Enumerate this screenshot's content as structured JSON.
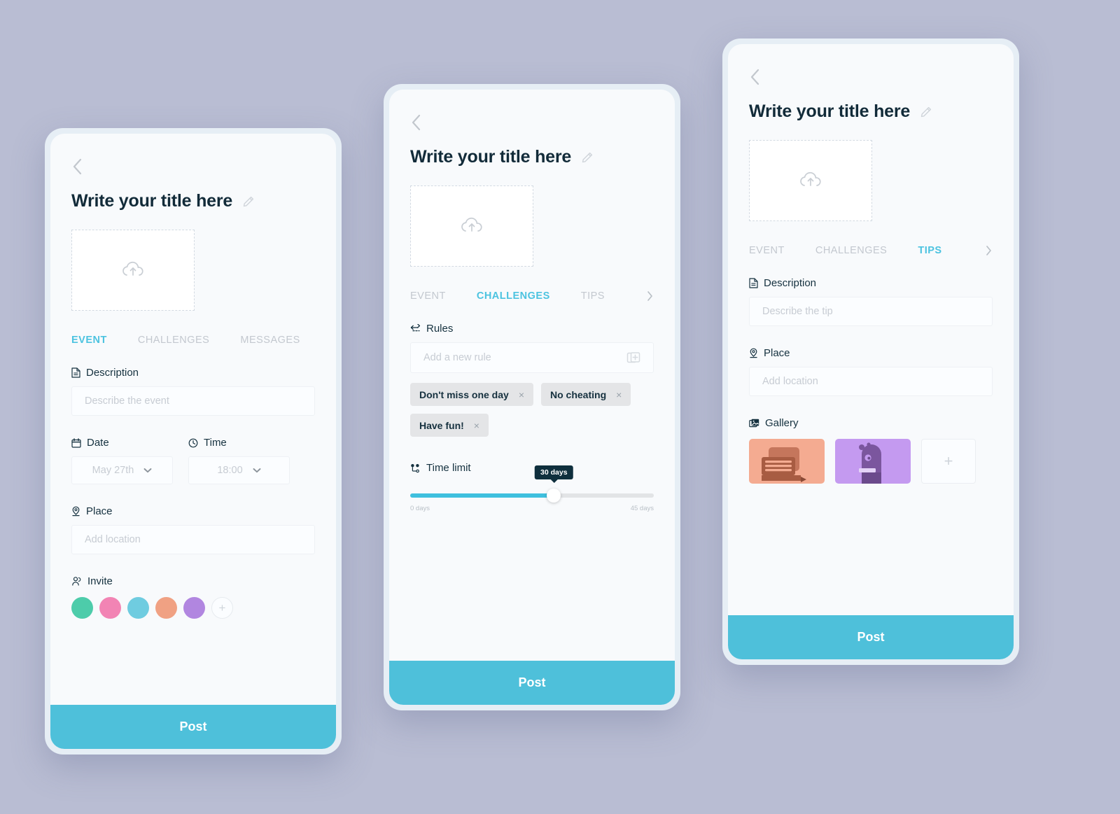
{
  "theme": {
    "page_bg": "#b9bdd3",
    "accent": "#4cc3e0",
    "post_bg": "#4ec0da",
    "chip_bg": "#e4e5e7",
    "tooltip_bg": "#0f2f3d"
  },
  "common": {
    "title": "Write your title here",
    "post_label": "Post",
    "back_icon": "chevron-left-icon",
    "edit_icon": "pencil-icon",
    "upload_icon": "cloud-upload-icon",
    "add_symbol": "+"
  },
  "screens": [
    {
      "id": "event",
      "title": "Write your title here",
      "tabs": [
        {
          "label": "EVENT",
          "active": true
        },
        {
          "label": "CHALLENGES",
          "active": false
        },
        {
          "label": "MESSAGES",
          "active": false
        }
      ],
      "has_tab_chevron": false,
      "description": {
        "label": "Description",
        "icon": "document-icon",
        "placeholder": "Describe the event"
      },
      "date": {
        "label": "Date",
        "icon": "calendar-icon",
        "value": "May 27th"
      },
      "time": {
        "label": "Time",
        "icon": "clock-icon",
        "value": "18:00"
      },
      "place": {
        "label": "Place",
        "icon": "location-pin-icon",
        "placeholder": "Add location"
      },
      "invite": {
        "label": "Invite",
        "icon": "people-icon",
        "avatars": [
          "#4dccaa",
          "#f284b4",
          "#6fcce0",
          "#f0a183",
          "#b186e0"
        ],
        "add_label": "+"
      },
      "post_label": "Post"
    },
    {
      "id": "challenges",
      "title": "Write your title here",
      "tabs": [
        {
          "label": "EVENT",
          "active": false
        },
        {
          "label": "CHALLENGES",
          "active": true
        },
        {
          "label": "TIPS",
          "active": false
        }
      ],
      "has_tab_chevron": true,
      "rules": {
        "label": "Rules",
        "icon": "exchange-arrows-icon",
        "placeholder": "Add a new rule",
        "add_icon": "duplicate-plus-icon",
        "chips": [
          "Don't miss one day",
          "No cheating",
          "Have fun!"
        ],
        "chip_remove_symbol": "×"
      },
      "time_limit": {
        "label": "Time limit",
        "icon": "nodes-icon",
        "value_label": "30 days",
        "min_label": "0 days",
        "max_label": "45 days",
        "fill_percent": 59
      },
      "post_label": "Post"
    },
    {
      "id": "tips",
      "title": "Write your title here",
      "tabs": [
        {
          "label": "EVENT",
          "active": false
        },
        {
          "label": "CHALLENGES",
          "active": false
        },
        {
          "label": "TIPS",
          "active": true
        }
      ],
      "has_tab_chevron": true,
      "description": {
        "label": "Description",
        "icon": "document-icon",
        "placeholder": "Describe the tip"
      },
      "place": {
        "label": "Place",
        "icon": "location-pin-icon",
        "placeholder": "Add location"
      },
      "gallery": {
        "label": "Gallery",
        "icon": "photos-icon",
        "thumbs": [
          {
            "name": "thumbnail-sofa-illustration",
            "bg": "#f4ab91",
            "fg": "#c5765c",
            "fg2": "#a85c42"
          },
          {
            "name": "thumbnail-character-illustration",
            "bg": "#c49af0",
            "fg": "#7b569e",
            "fg2": "#6b4a8c"
          }
        ],
        "add_label": "+"
      },
      "post_label": "Post"
    }
  ]
}
